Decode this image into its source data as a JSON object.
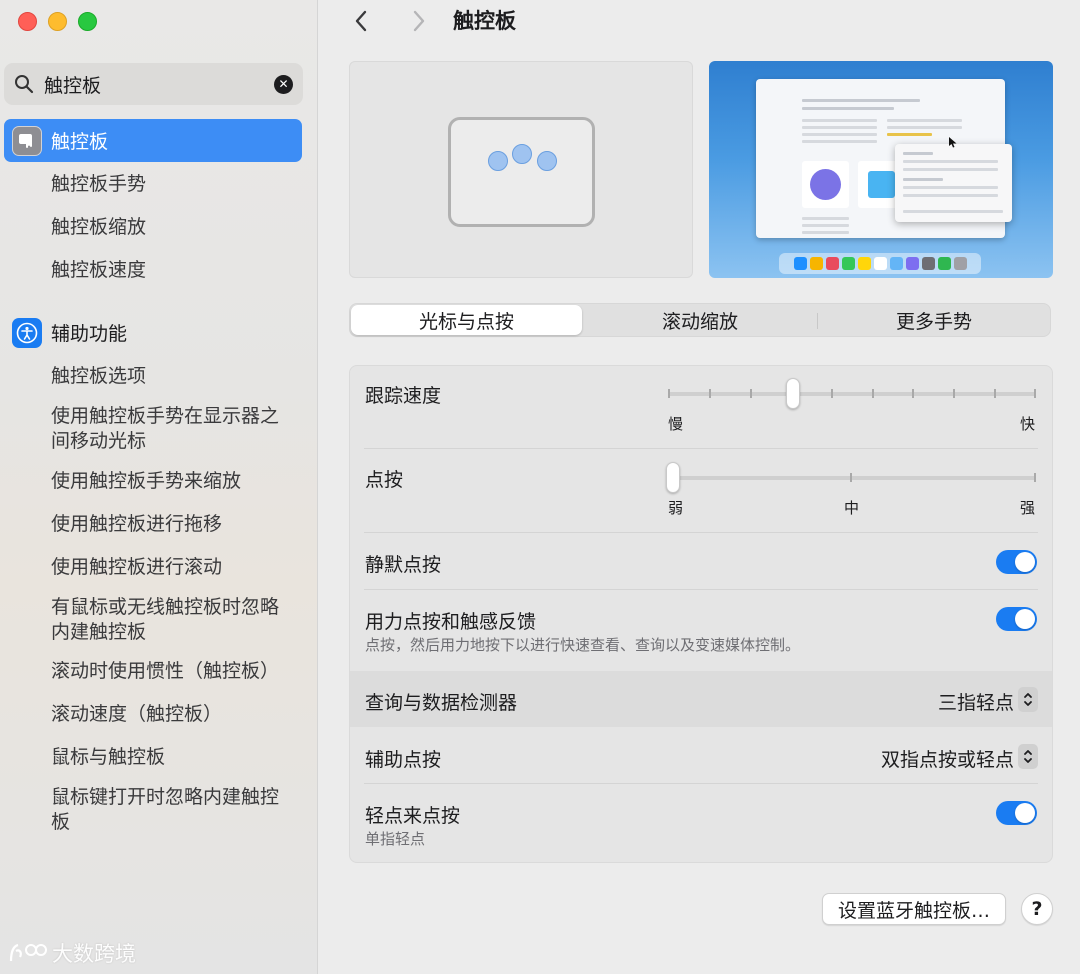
{
  "window": {
    "title": "触控板"
  },
  "sidebar": {
    "search": {
      "query": "触控板"
    },
    "sections": [
      {
        "label": "触控板",
        "icon": "trackpad-icon",
        "items": [
          "触控板手势",
          "触控板缩放",
          "触控板速度"
        ]
      },
      {
        "label": "辅助功能",
        "icon": "accessibility-icon",
        "items": [
          "触控板选项",
          "使用触控板手势在显示器之间移动光标",
          "使用触控板手势来缩放",
          "使用触控板进行拖移",
          "使用触控板进行滚动",
          "有鼠标或无线触控板时忽略内建触控板",
          "滚动时使用惯性（触控板）",
          "滚动速度（触控板）",
          "鼠标与触控板",
          "鼠标键打开时忽略内建触控板"
        ]
      }
    ],
    "watermark": "大数跨境"
  },
  "tabs": [
    "光标与点按",
    "滚动缩放",
    "更多手势"
  ],
  "settings": {
    "tracking_speed": {
      "label": "跟踪速度",
      "min_label": "慢",
      "max_label": "快",
      "value_fraction": 0.34
    },
    "click": {
      "label": "点按",
      "labels": [
        "弱",
        "中",
        "强"
      ],
      "value_fraction": 0.0
    },
    "silent_click": {
      "label": "静默点按",
      "on": true
    },
    "force_click": {
      "label": "用力点按和触感反馈",
      "description": "点按，然后用力地按下以进行快速查看、查询以及变速媒体控制。",
      "on": true
    },
    "lookup": {
      "label": "查询与数据检测器",
      "value": "三指轻点"
    },
    "secondary_click": {
      "label": "辅助点按",
      "value": "双指点按或轻点"
    },
    "tap_to_click": {
      "label": "轻点来点按",
      "description": "单指轻点",
      "on": true
    }
  },
  "footer": {
    "bluetooth_button": "设置蓝牙触控板…",
    "help_button": "?"
  },
  "colors": {
    "accent": "#1a7cf2",
    "selected_sidebar": "#3d8df5"
  }
}
